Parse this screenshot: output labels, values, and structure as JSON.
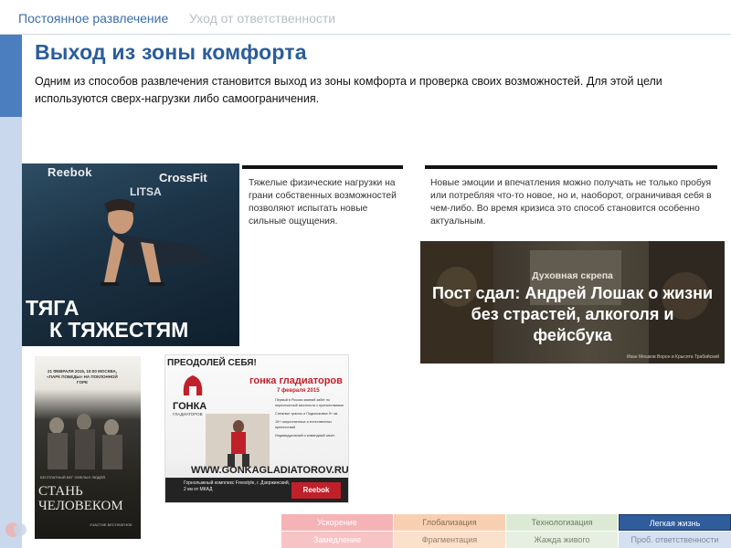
{
  "header": {
    "tab_active": "Постоянное развлечение",
    "tab_inactive": "Уход от ответственности"
  },
  "slide": {
    "title": "Выход из зоны комфорта",
    "description": "Одним из способов развлечения становится выход из зоны комфорта и проверка своих возможностей. Для этой цели используются сверх-нагрузки либо самоограничения."
  },
  "columns": {
    "col1_text": "Тяжелые физические нагрузки на грани собственных возможностей позволяют испытать новые сильные ощущения.",
    "col2_text": "Новые эмоции и впечатления можно получать не только пробуя или потребляя что-то новое, но и, наоборот, ограничивая себя в чем-либо. Во время кризиса это способ становится особенно актуальным."
  },
  "images": {
    "reebok": {
      "logo": "Reebok",
      "crossfit": "CrossFit",
      "litsa": "LITSA",
      "caption_line1": "ТЯГА",
      "caption_line2": "К ТЯЖЕСТЯМ"
    },
    "lossak": {
      "kicker": "Духовная скрепа",
      "headline": "Пост сдал: Андрей Лошак о жизни без страстей, алкоголя и фейсбука",
      "credit": "Иван Мешков Ворон и Крысята Трабийский"
    },
    "poster": {
      "date": "21 ФЕВРАЛЯ 2015, 10:00 МОСКВА, «ПАРК ПОБЕДЫ» НА ПОКЛОННОЙ ГОРЕ",
      "small": "БЕСПЛАТНЫЙ БЕГ СМЕЛЫХ ЛЮДЕЙ",
      "big": "СТАНЬ ЧЕЛОВЕКОМ",
      "foot": "УЧАСТИЕ БЕСПЛАТНОЕ"
    },
    "gladiator": {
      "top": "ПРЕОДОЛЕЙ СЕБЯ!",
      "brand": "ГОНКА",
      "brand2": "ГЛАДИАТОРОВ",
      "title": "гонка гладиаторов",
      "date": "7 февраля 2015",
      "points": [
        "Первый в России зимний забег по пересеченной местности с препятствиями",
        "Снежные трассы и Подмосковье 5+ км",
        "15+ искусственных и естественных препятствий",
        "Индивидуальный и командный зачет"
      ],
      "site": "WWW.GONKAGLADIATOROV.RU",
      "bottom": "Горнолыжный комплекс Freestyle, г. Дзержинский, 2 км от МКАД",
      "reebok": "Reebok"
    }
  },
  "grid": {
    "row1": [
      "Ускорение",
      "Глобализация",
      "Технологизация",
      "Легкая жизнь"
    ],
    "row2": [
      "Замедление",
      "Фрагментация",
      "Жажда живого",
      "Проб. ответственности"
    ]
  },
  "colors": {
    "title_blue": "#2a5d9a",
    "tab_active": "#3b6ea8",
    "side_dark": "#4a7ebf",
    "side_light": "#c9d8ec",
    "grid_active": "#2f5c9b"
  },
  "icons": [
    "corner-logo-icon"
  ]
}
